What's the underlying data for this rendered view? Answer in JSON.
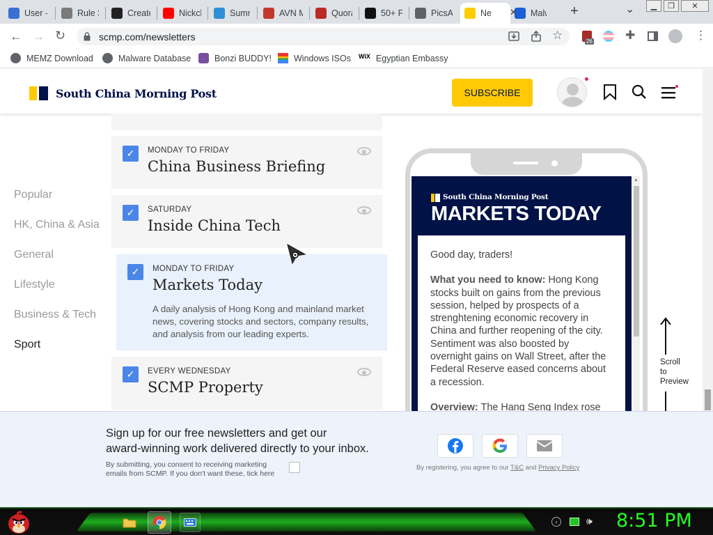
{
  "browser": {
    "tabs": [
      {
        "label": "User -",
        "icon": "edge-icon",
        "color": "#3b6fd4"
      },
      {
        "label": "Rule 3",
        "icon": "image-icon",
        "color": "#7a7a7a"
      },
      {
        "label": "Create",
        "icon": "wikipedia-icon",
        "color": "#222222"
      },
      {
        "label": "Nickcl",
        "icon": "youtube-icon",
        "color": "#ff0000"
      },
      {
        "label": "Summ",
        "icon": "gif-icon",
        "color": "#2d8fd5"
      },
      {
        "label": "AVN M",
        "icon": "avn-icon",
        "color": "#c0392b"
      },
      {
        "label": "Quora",
        "icon": "quora-icon",
        "color": "#b92b27"
      },
      {
        "label": "50+ F",
        "icon": "film-icon",
        "color": "#111111"
      },
      {
        "label": "PicsAr",
        "icon": "globe-icon",
        "color": "#5f6368"
      },
      {
        "label": "Ne",
        "icon": "scmp-icon",
        "color": "#ffcc00",
        "active": true
      },
      {
        "label": "Malw",
        "icon": "malwarebytes-icon",
        "color": "#1a5fd6"
      }
    ],
    "close_tab": "✕",
    "new_tab": "+",
    "tab_search": "⌄",
    "url": "scmp.com/newsletters",
    "extension_badge": "26",
    "bookmarks": [
      {
        "label": "MEMZ Download",
        "icon": "globe-icon"
      },
      {
        "label": "Malware Database",
        "icon": "globe-icon"
      },
      {
        "label": "Bonzi BUDDY!",
        "icon": "bonzi-icon"
      },
      {
        "label": "Windows ISOs",
        "icon": "windows-flag-icon"
      },
      {
        "label": "Egyptian Embassy",
        "icon": "wix-icon"
      }
    ],
    "wix_label": "WiX"
  },
  "site": {
    "brand": "South China Morning Post",
    "subscribe": "SUBSCRIBE",
    "nav": [
      {
        "label": "Popular"
      },
      {
        "label": "HK, China & Asia"
      },
      {
        "label": "General"
      },
      {
        "label": "Lifestyle"
      },
      {
        "label": "Business & Tech"
      },
      {
        "label": "Sport",
        "active": true
      }
    ],
    "newsletters": [
      {
        "freq": "MONDAY TO FRIDAY",
        "title": "China Business Briefing"
      },
      {
        "freq": "SATURDAY",
        "title": "Inside China Tech"
      },
      {
        "freq": "MONDAY TO FRIDAY",
        "title": "Markets Today",
        "desc": "A daily analysis of Hong Kong and mainland market news, covering stocks and sectors, company results, and analysis from our leading experts.",
        "selected": true
      },
      {
        "freq": "EVERY WEDNESDAY",
        "title": "SCMP Property"
      }
    ],
    "preview": {
      "brand": "South China Morning Post",
      "title": "MARKETS TODAY",
      "greeting": "Good day, traders!",
      "need_label": "What you need to know:",
      "need_text": " Hong Kong stocks built on gains from the previous session, helped by prospects of a strenghtening economic recovery in China and further reopening of the city. Sentiment was also boosted by overnight gains on Wall Street, after the Federal Reserve eased concerns about a recession.",
      "overview_label": "Overview:",
      "overview_text": " The Hang Seng Index rose"
    },
    "scroll_hint": [
      "Scroll",
      "to",
      "Preview"
    ],
    "signup": {
      "headline1": "Sign up for our free newsletters and get our",
      "headline2": "award-winning work delivered directly to your inbox.",
      "consent1": "By submitting, you consent to receiving marketing",
      "consent2": "emails from SCMP. If you don't want these, tick here",
      "terms_pre": "By registering, you agree to our ",
      "tc": "T&C",
      "and": " and ",
      "privacy": "Privacy Policy"
    }
  },
  "taskbar": {
    "clock": "8:51 PM"
  },
  "colors": {
    "accent": "#ffca05",
    "navy": "#001246",
    "checkbox": "#4a86e8",
    "clock": "#22ff22"
  }
}
